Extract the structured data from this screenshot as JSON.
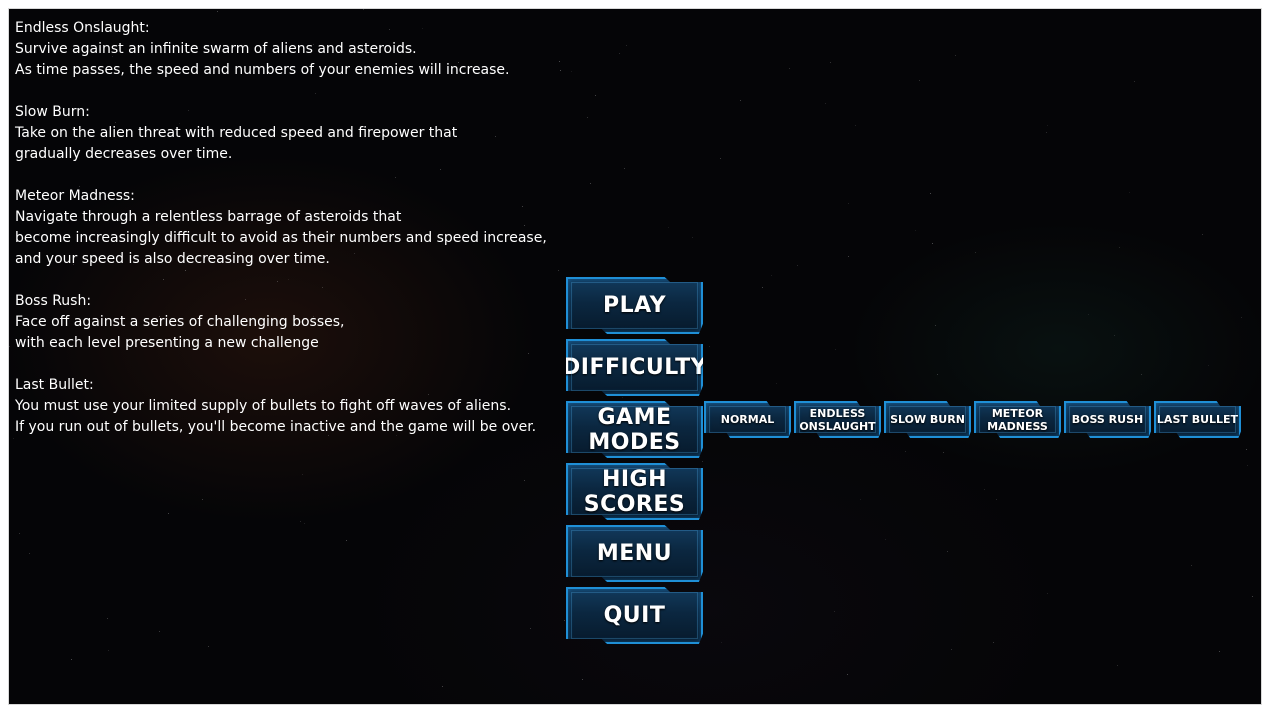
{
  "mode_descriptions": [
    {
      "title": "Endless Onslaught:",
      "lines": [
        "Survive against an infinite swarm of aliens and asteroids.",
        "As time passes, the speed and numbers of your enemies will increase."
      ]
    },
    {
      "title": "Slow Burn:",
      "lines": [
        "Take on the alien threat with reduced speed and firepower that",
        "gradually decreases over time."
      ]
    },
    {
      "title": "Meteor Madness:",
      "lines": [
        "Navigate through a relentless barrage of asteroids that",
        "become increasingly difficult to avoid as their numbers and speed increase,",
        "and your speed is also decreasing over time."
      ]
    },
    {
      "title": "Boss Rush:",
      "lines": [
        "Face off against a series of challenging bosses,",
        "with each level presenting a new challenge"
      ]
    },
    {
      "title": "Last Bullet:",
      "lines": [
        "You must use your limited supply of bullets to fight off waves of aliens.",
        "If you run out of bullets, you'll become inactive and the game will be over."
      ]
    }
  ],
  "main_menu": {
    "play": "PLAY",
    "difficulty": "DIFFICULTY",
    "game_modes": "GAME MODES",
    "high_scores": "HIGH SCORES",
    "menu": "MENU",
    "quit": "QUIT"
  },
  "game_modes_menu": {
    "normal": "NORMAL",
    "endless_onslaught_1": "ENDLESS",
    "endless_onslaught_2": "ONSLAUGHT",
    "slow_burn": "SLOW BURN",
    "meteor_madness_1": "METEOR",
    "meteor_madness_2": "MADNESS",
    "boss_rush": "BOSS RUSH",
    "last_bullet": "LAST BULLET"
  },
  "colors": {
    "background": "#050507",
    "text": "#ffffff",
    "button_border": "#1f8fd6",
    "button_fill": "#0b2740"
  }
}
